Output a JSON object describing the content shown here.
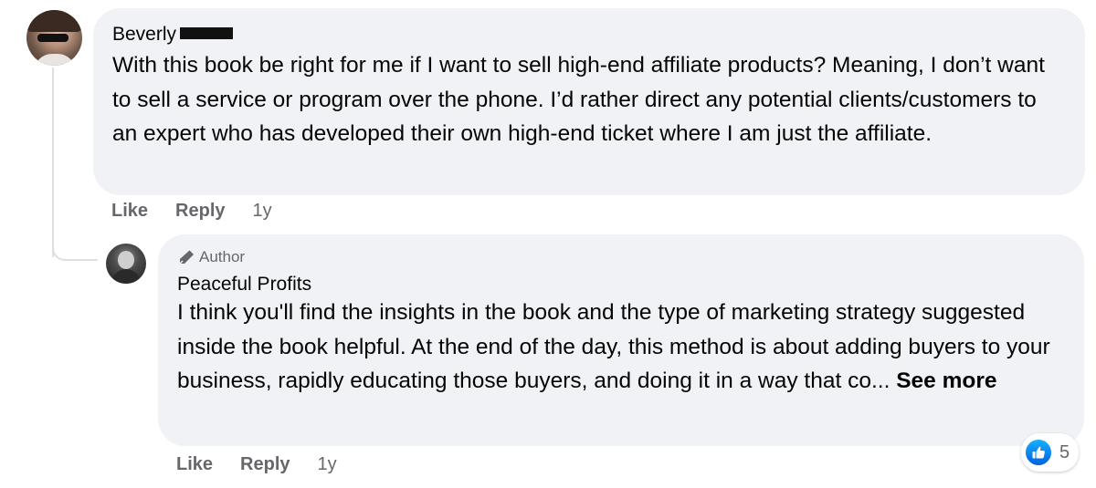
{
  "comment": {
    "author": "Beverly",
    "author_surname_redacted": true,
    "text": "With this book be right for me if I want to sell high-end affiliate products? Meaning, I don’t want to sell a service or program over the phone. I’d rather direct any potential clients/customers to an expert who has developed their own high-end ticket where I am just the affiliate.",
    "actions": {
      "like_label": "Like",
      "reply_label": "Reply",
      "timestamp": "1y"
    }
  },
  "reply": {
    "badge_label": "Author",
    "author": "Peaceful Profits",
    "text": "I think you'll find the insights in the book and the type of marketing strategy suggested inside the book helpful. At the end of the day, this method is about adding buyers to your business, rapidly educating those buyers, and doing it in a way that co...",
    "see_more_label": "See more",
    "actions": {
      "like_label": "Like",
      "reply_label": "Reply",
      "timestamp": "1y"
    },
    "reaction": {
      "icon": "thumbs-up-icon",
      "color": "#1877f2",
      "count": "5"
    }
  },
  "colors": {
    "bubble_bg": "#f0f2f5",
    "secondary_text": "#65676b",
    "primary_text": "#050505"
  }
}
